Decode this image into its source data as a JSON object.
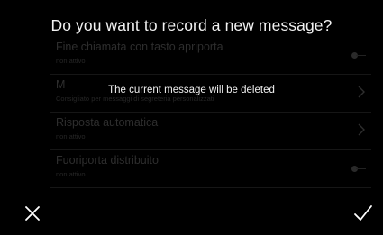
{
  "dialog": {
    "title": "Do you want to record a new message?",
    "message": "The current message will be deleted",
    "cancel_icon": "close-icon",
    "confirm_icon": "check-icon"
  },
  "settings": {
    "items": [
      {
        "title": "Fine chiamata con tasto apriporta",
        "subtitle": "non attivo",
        "control": "toggle-icon"
      },
      {
        "title": "M",
        "subtitle": "Consigliato per messaggi di segreteria personalizzati",
        "control": "chevron-right-icon"
      },
      {
        "title": "Risposta automatica",
        "subtitle": "non attivo",
        "control": "chevron-right-icon"
      },
      {
        "title": "Fuoriporta distribuito",
        "subtitle": "non attivo",
        "control": "toggle-icon"
      }
    ]
  },
  "colors": {
    "background": "#000000",
    "text": "#ffffff",
    "dimmed_text": "#2e2e2e"
  }
}
